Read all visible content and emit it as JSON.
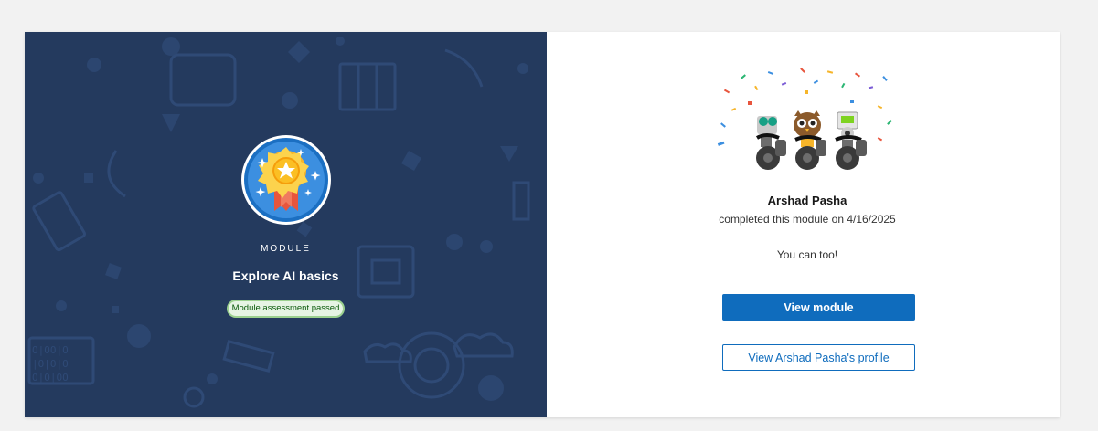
{
  "module": {
    "label": "MODULE",
    "title": "Explore AI basics",
    "status_pill": "Module assessment passed"
  },
  "achievement": {
    "user_name": "Arshad Pasha",
    "completed_text": "completed this module on 4/16/2025",
    "encouragement": "You can too!"
  },
  "actions": {
    "view_module_label": "View module",
    "view_profile_label": "View Arshad Pasha's profile"
  },
  "colors": {
    "left_panel_bg": "#243a5e",
    "primary": "#0f6cbd",
    "pill_bg": "#e6f4e4",
    "pill_text": "#0b5a0b"
  },
  "icons": {
    "badge": "medal-ribbon-star-icon",
    "celebration": "mascots-confetti-illustration"
  }
}
